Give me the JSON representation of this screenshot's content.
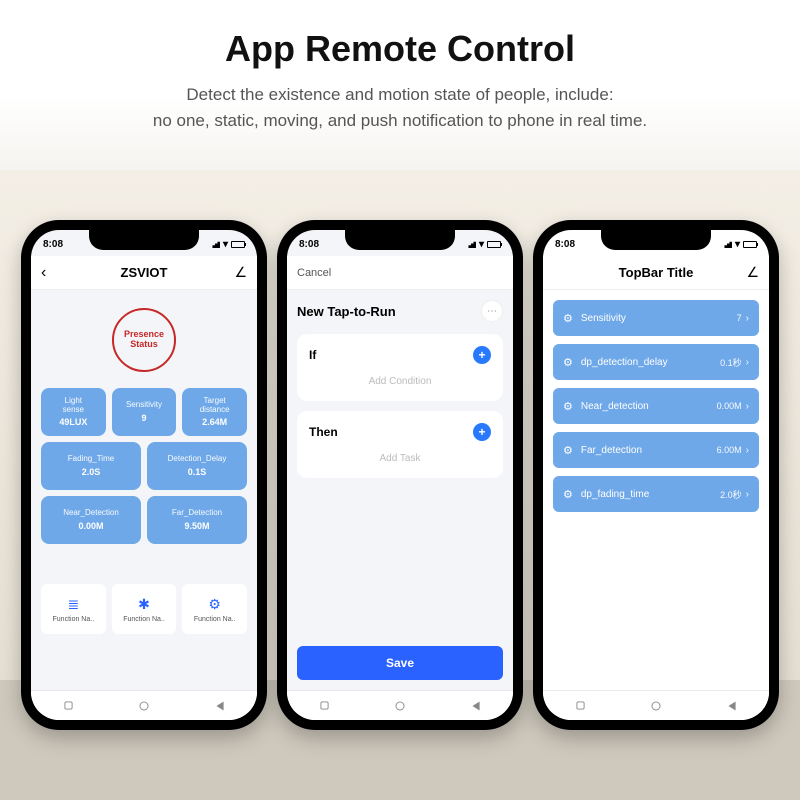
{
  "heading": {
    "title": "App Remote Control",
    "subtitle_line1": "Detect the existence and motion state of people, include:",
    "subtitle_line2": "no one, static, moving, and push notification to phone in real time."
  },
  "status": {
    "time": "8:08"
  },
  "phone1": {
    "topbar_title": "ZSVIOT",
    "back": "‹",
    "edit": "∠",
    "presence_label": "Presence\nStatus",
    "tiles": [
      {
        "label": "Light\nsense",
        "value": "49LUX"
      },
      {
        "label": "Sensitivity",
        "value": "9"
      },
      {
        "label": "Target\ndistance",
        "value": "2.64M"
      },
      {
        "label": "Fading_Time",
        "value": "2.0S"
      },
      {
        "label": "Detection_Delay",
        "value": "0.1S"
      },
      {
        "label": "Near_Detection",
        "value": "0.00M"
      },
      {
        "label": "Far_Detection",
        "value": "9.50M"
      }
    ],
    "fn_label": "Function Na..",
    "fn_icons": [
      "≣",
      "✱",
      "⚙"
    ]
  },
  "phone2": {
    "cancel": "Cancel",
    "title": "New Tap-to-Run",
    "dots": "⋯",
    "if_label": "If",
    "if_hint": "Add Condition",
    "then_label": "Then",
    "then_hint": "Add Task",
    "save": "Save"
  },
  "phone3": {
    "topbar_title": "TopBar Title",
    "edit": "∠",
    "items": [
      {
        "name": "Sensitivity",
        "value": "7"
      },
      {
        "name": "dp_detection_delay",
        "value": "0.1秒"
      },
      {
        "name": "Near_detection",
        "value": "0.00M"
      },
      {
        "name": "Far_detection",
        "value": "6.00M"
      },
      {
        "name": "dp_fading_time",
        "value": "2.0秒"
      }
    ]
  }
}
